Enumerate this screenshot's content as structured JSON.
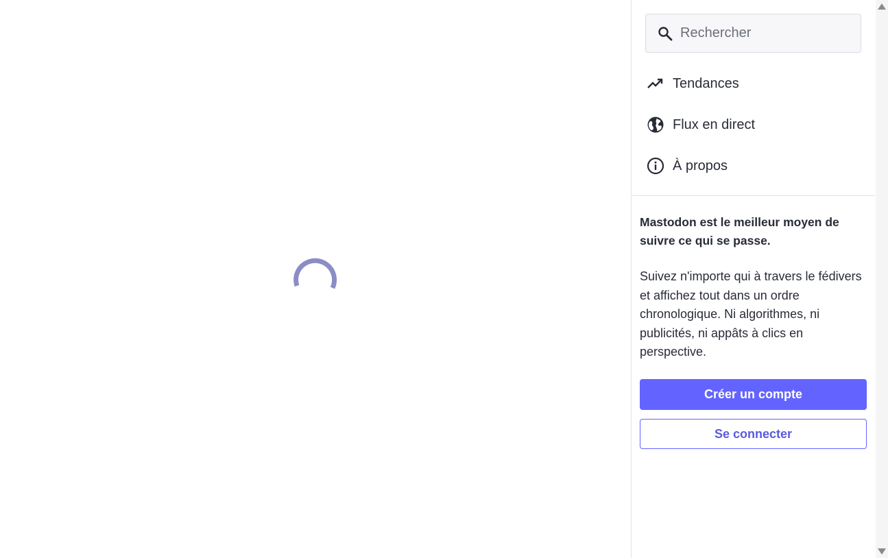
{
  "search": {
    "placeholder": "Rechercher"
  },
  "nav": {
    "items": [
      {
        "label": "Tendances",
        "icon": "trending-up-icon"
      },
      {
        "label": "Flux en direct",
        "icon": "globe-icon"
      },
      {
        "label": "À propos",
        "icon": "info-icon"
      }
    ]
  },
  "promo": {
    "headline": "Mastodon est le meilleur moyen de suivre ce qui se passe.",
    "body": "Suivez n'importe qui à travers le fédivers et affichez tout dans un ordre chronologique. Ni algorithmes, ni publicités, ni appâts à clics en perspective."
  },
  "buttons": {
    "signup_label": "Créer un compte",
    "login_label": "Se connecter"
  },
  "colors": {
    "accent": "#6364ff",
    "spinner": "#8c8dc6",
    "text": "#282c37"
  }
}
